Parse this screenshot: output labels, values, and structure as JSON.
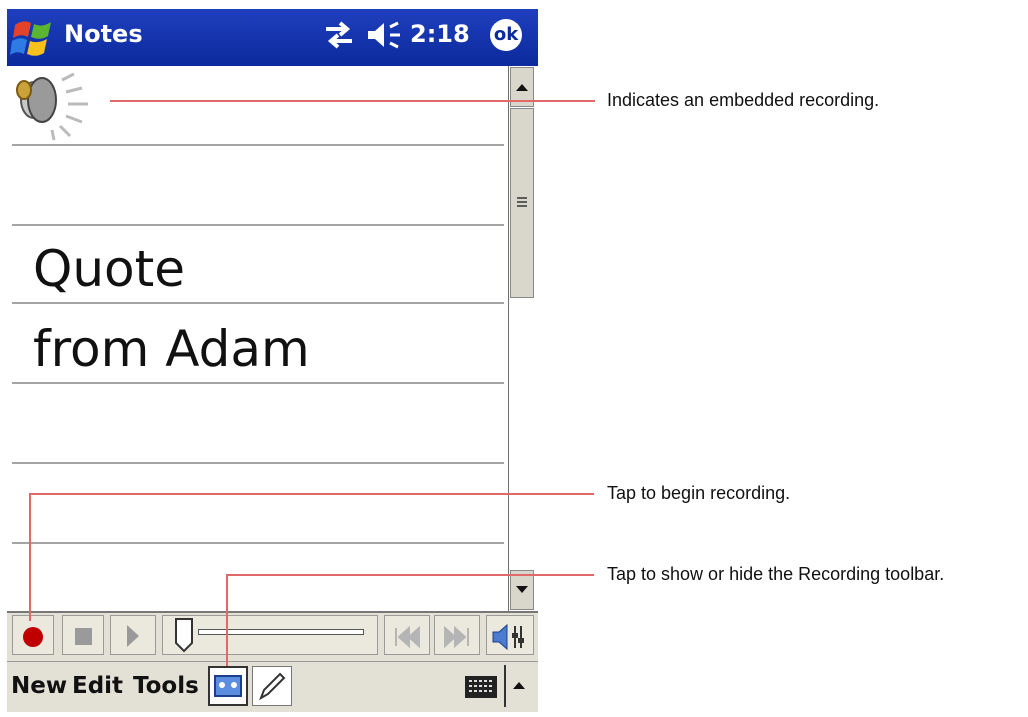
{
  "titlebar": {
    "app_title": "Notes",
    "clock": "2:18",
    "ok_label": "ok"
  },
  "note": {
    "line1": "Quote",
    "line2": "from Adam",
    "embedded_icon": "speaker-icon"
  },
  "recording_toolbar": {
    "buttons": [
      "record-icon",
      "stop-icon",
      "play-icon",
      "slider",
      "skip-back-icon",
      "skip-forward-icon",
      "speaker-volume-icon"
    ]
  },
  "menubar": {
    "new": "New",
    "edit": "Edit",
    "tools": "Tools"
  },
  "callouts": {
    "embedded": "Indicates an embedded recording.",
    "record": "Tap to begin recording.",
    "toolbar": "Tap to show or hide the Recording toolbar."
  },
  "colors": {
    "titlebar": "#0b2a9c",
    "callout_line": "#e06a6a",
    "record": "#c00000"
  }
}
